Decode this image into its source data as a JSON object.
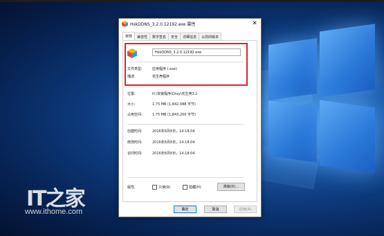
{
  "watermark": {
    "logo": "IT之家",
    "url": "www.ithome.com"
  },
  "dialog": {
    "title": "HskDDNS_3.2.0.12192.exe 属性",
    "close_glyph": "✕",
    "tabs": [
      "常规",
      "兼容性",
      "数字签名",
      "安全",
      "详细信息",
      "以前的版本"
    ],
    "file_name": "HskDDNS_3.2.0.12192.exe",
    "rows_top": [
      {
        "label": "文件类型:",
        "value": "应用程序 (.exe)"
      },
      {
        "label": "描述:",
        "value": "花生壳程序"
      }
    ],
    "rows_mid": [
      {
        "label": "位置:",
        "value": "H:\\安装程序\\Oray\\花生壳3.2"
      },
      {
        "label": "大小:",
        "value": "1.75 MB (1,842,088 字节)"
      },
      {
        "label": "占用空间:",
        "value": "1.75 MB (1,843,200 字节)"
      }
    ],
    "rows_dates": [
      {
        "label": "创建时间:",
        "value": "2016年6月8日，14:18:04"
      },
      {
        "label": "修改时间:",
        "value": "2016年6月8日，14:18:04"
      },
      {
        "label": "访问时间:",
        "value": "2016年6月8日，14:18:04"
      }
    ],
    "attributes": {
      "label": "属性:",
      "readonly": "只读(R)",
      "hidden": "隐藏(H)",
      "readonly_checked": false,
      "hidden_checked": false,
      "advanced": "高级(D)..."
    },
    "buttons": {
      "ok": "确定",
      "cancel": "取消",
      "apply": "应用(A)"
    }
  },
  "colors": {
    "highlight_border": "#d9232e",
    "desktop_accent": "#2a78d8"
  }
}
